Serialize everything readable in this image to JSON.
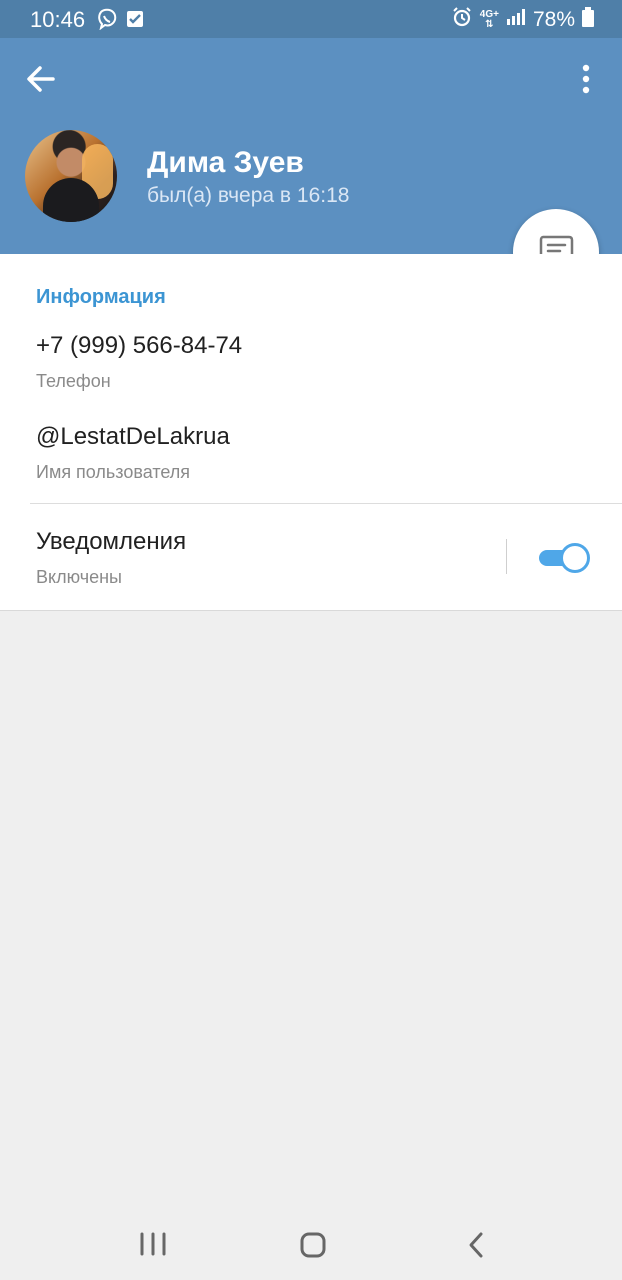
{
  "status_bar": {
    "time": "10:46",
    "network": "4G+",
    "battery": "78%"
  },
  "profile": {
    "name": "Дима Зуев",
    "last_seen": "был(а) вчера в 16:18"
  },
  "info": {
    "section_title": "Информация",
    "phone": "+7 (999) 566-84-74",
    "phone_label": "Телефон",
    "username": "@LestatDeLakrua",
    "username_label": "Имя пользователя",
    "notifications_title": "Уведомления",
    "notifications_state": "Включены"
  },
  "colors": {
    "header": "#5c90c1",
    "status_bar": "#4f7fa8",
    "accent": "#3c95d3",
    "toggle": "#4fa7e8"
  },
  "icons": [
    "back-arrow-icon",
    "more-vertical-icon",
    "message-icon",
    "viber-icon",
    "checkbox-icon",
    "alarm-icon",
    "signal-icon",
    "battery-icon"
  ]
}
